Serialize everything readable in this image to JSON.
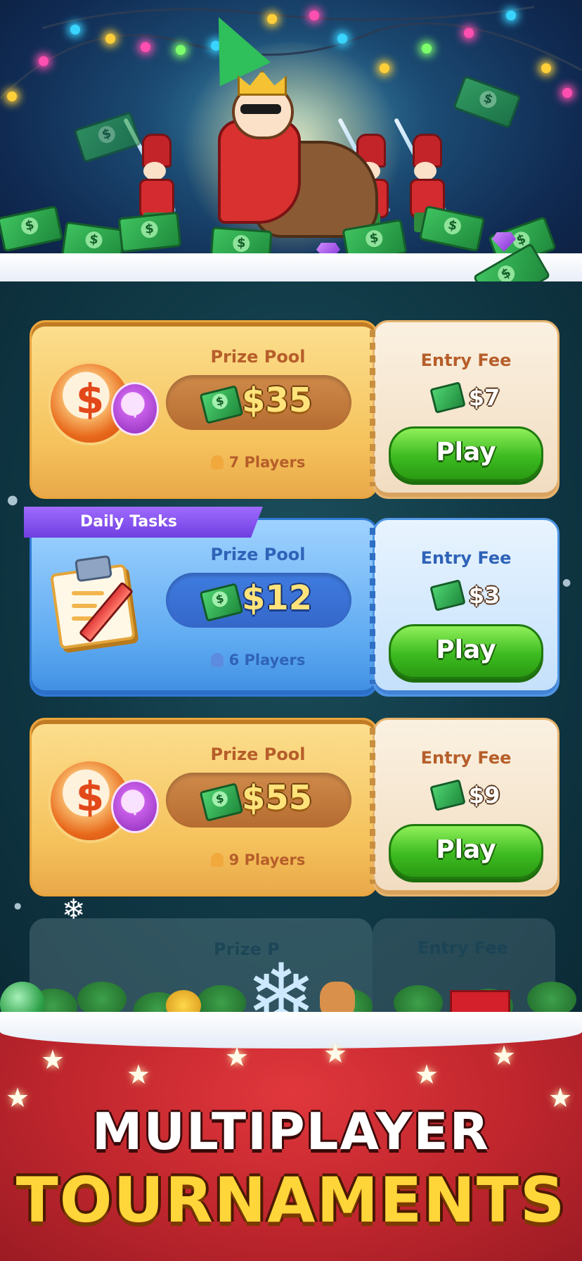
{
  "tournaments": [
    {
      "style": "gold",
      "icon": "dollar-coin-icon",
      "badge": "",
      "prize_label": "Prize Pool",
      "prize": "$35",
      "players": "7 Players",
      "fee_label": "Entry Fee",
      "fee": "$7",
      "button": "Play"
    },
    {
      "style": "blue",
      "icon": "clipboard-icon",
      "badge": "Daily Tasks",
      "prize_label": "Prize Pool",
      "prize": "$12",
      "players": "6 Players",
      "fee_label": "Entry Fee",
      "fee": "$3",
      "button": "Play"
    },
    {
      "style": "gold",
      "icon": "dollar-coin-icon",
      "badge": "",
      "prize_label": "Prize Pool",
      "prize": "$55",
      "players": "9 Players",
      "fee_label": "Entry Fee",
      "fee": "$9",
      "button": "Play"
    }
  ],
  "partial_card": {
    "prize_label": "Prize P",
    "fee_label": "Entry Fee"
  },
  "coin_symbol": "$",
  "banner": {
    "line1": "MULTIPLAYER",
    "line2": "TOURNAMENTS"
  },
  "colors": {
    "gold_card": "#f5c25c",
    "blue_card": "#5eaaf1",
    "play_button": "#3dbb21",
    "banner_red": "#c0262d",
    "headline_yellow": "#ffd63a"
  }
}
